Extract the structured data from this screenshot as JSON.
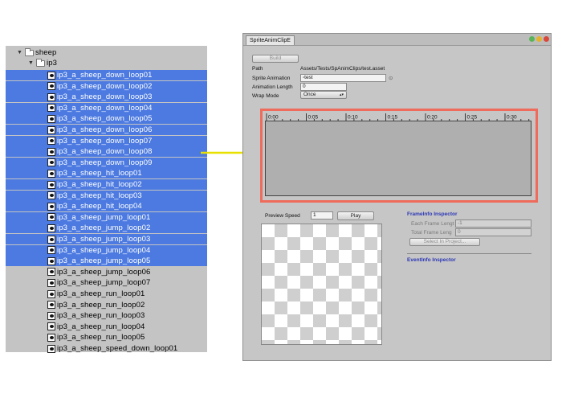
{
  "tree": {
    "root_folder": "sheep",
    "sub_folder": "ip3",
    "files": [
      {
        "name": "ip3_a_sheep_down_loop01",
        "selected": true
      },
      {
        "name": "ip3_a_sheep_down_loop02",
        "selected": true
      },
      {
        "name": "ip3_a_sheep_down_loop03",
        "selected": true
      },
      {
        "name": "ip3_a_sheep_down_loop04",
        "selected": true
      },
      {
        "name": "ip3_a_sheep_down_loop05",
        "selected": true
      },
      {
        "name": "ip3_a_sheep_down_loop06",
        "selected": true
      },
      {
        "name": "ip3_a_sheep_down_loop07",
        "selected": true
      },
      {
        "name": "ip3_a_sheep_down_loop08",
        "selected": true
      },
      {
        "name": "ip3_a_sheep_down_loop09",
        "selected": true
      },
      {
        "name": "ip3_a_sheep_hit_loop01",
        "selected": true
      },
      {
        "name": "ip3_a_sheep_hit_loop02",
        "selected": true
      },
      {
        "name": "ip3_a_sheep_hit_loop03",
        "selected": true
      },
      {
        "name": "ip3_a_sheep_hit_loop04",
        "selected": true
      },
      {
        "name": "ip3_a_sheep_jump_loop01",
        "selected": true
      },
      {
        "name": "ip3_a_sheep_jump_loop02",
        "selected": true
      },
      {
        "name": "ip3_a_sheep_jump_loop03",
        "selected": true
      },
      {
        "name": "ip3_a_sheep_jump_loop04",
        "selected": true
      },
      {
        "name": "ip3_a_sheep_jump_loop05",
        "selected": true
      },
      {
        "name": "ip3_a_sheep_jump_loop06",
        "selected": false
      },
      {
        "name": "ip3_a_sheep_jump_loop07",
        "selected": false
      },
      {
        "name": "ip3_a_sheep_run_loop01",
        "selected": false
      },
      {
        "name": "ip3_a_sheep_run_loop02",
        "selected": false
      },
      {
        "name": "ip3_a_sheep_run_loop03",
        "selected": false
      },
      {
        "name": "ip3_a_sheep_run_loop04",
        "selected": false
      },
      {
        "name": "ip3_a_sheep_run_loop05",
        "selected": false
      },
      {
        "name": "ip3_a_sheep_speed_down_loop01",
        "selected": false
      }
    ]
  },
  "window": {
    "tab_title": "SpriteAnimClipE",
    "build_label": "Build",
    "path_label": "Path",
    "path_value": "Assets/Tests/SpAnimClips/test.asset",
    "sprite_animation_label": "Sprite Animation",
    "sprite_animation_value": "test",
    "animation_length_label": "Animation Length",
    "animation_length_value": "0",
    "wrap_mode_label": "Wrap Mode",
    "wrap_mode_value": "Once",
    "timeline_labels": [
      "0:00",
      "0:05",
      "0:10",
      "0:15",
      "0:20",
      "0:25",
      "0:30"
    ],
    "preview_speed_label": "Preview Speed",
    "preview_speed_value": "1",
    "play_label": "Play",
    "frameinfo_title": "FrameInfo Inspector",
    "each_frame_label": "Each Frame Lengt",
    "each_frame_value": "-1",
    "total_frame_label": "Total Frame Leng",
    "total_frame_value": "0",
    "select_in_project_label": "Select In Project...",
    "eventinfo_title": "EventInfo Inspector"
  },
  "colors": {
    "selection": "#4c7ae0",
    "panel_bg": "#c4c4c4",
    "highlight_box": "#ef6b5b",
    "arrow": "#e8e000",
    "inspector_title": "#2b37b6"
  }
}
